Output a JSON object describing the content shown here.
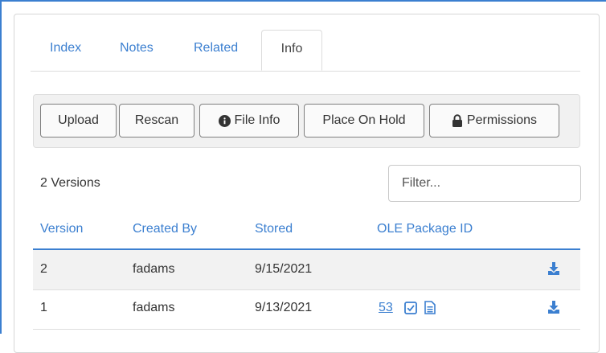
{
  "tabs": [
    {
      "label": "Index"
    },
    {
      "label": "Notes"
    },
    {
      "label": "Related"
    },
    {
      "label": "Info",
      "active": true
    }
  ],
  "toolbar": {
    "upload": "Upload",
    "rescan": "Rescan",
    "file_info": "File Info",
    "place_on_hold": "Place On Hold",
    "permissions": "Permissions"
  },
  "versions": {
    "count_label": "2 Versions",
    "filter_placeholder": "Filter..."
  },
  "table": {
    "columns": [
      "Version",
      "Created By",
      "Stored",
      "OLE Package ID"
    ],
    "rows": [
      {
        "version": "2",
        "created_by": "fadams",
        "stored": "9/15/2021",
        "ole_package_id": ""
      },
      {
        "version": "1",
        "created_by": "fadams",
        "stored": "9/13/2021",
        "ole_package_id": "53"
      }
    ]
  },
  "colors": {
    "accent": "#3b7fd0",
    "row_alt": "#f2f2f2"
  },
  "icons": [
    "info-circle-icon",
    "lock-icon",
    "download-icon",
    "checkbox-icon",
    "document-icon"
  ]
}
